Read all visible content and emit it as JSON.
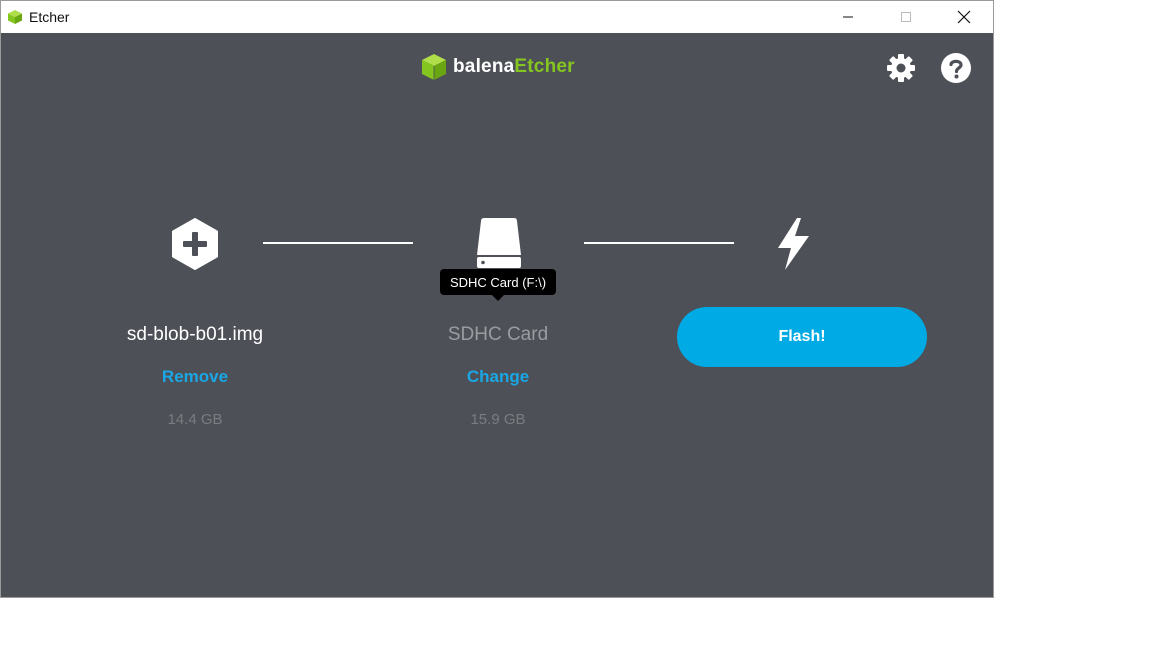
{
  "window": {
    "title": "Etcher",
    "controls": [
      "minimize",
      "maximize",
      "close"
    ]
  },
  "brand": {
    "prefix": "balena",
    "accent": "Etcher",
    "accent_color": "#85c51f"
  },
  "top_icons": [
    "settings-gear-icon",
    "help-icon"
  ],
  "steps": {
    "image": {
      "icon": "plus-hexagon-icon",
      "name": "sd-blob-b01.img",
      "action": "Remove",
      "size": "14.4 GB"
    },
    "drive": {
      "icon": "drive-icon",
      "name": "SDHC Card",
      "action": "Change",
      "size": "15.9 GB",
      "tooltip": "SDHC Card (F:\\)"
    },
    "flash": {
      "icon": "lightning-bolt-icon",
      "button_label": "Flash!"
    }
  },
  "colors": {
    "background": "#4d5057",
    "link": "#1aa7e6",
    "flash_button": "#00aae4",
    "muted_text": "#7a7c80"
  }
}
